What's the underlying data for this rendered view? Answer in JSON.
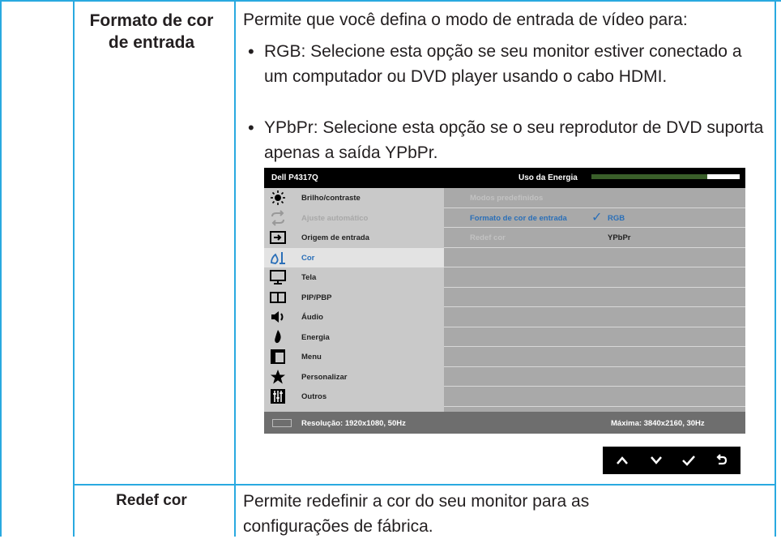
{
  "rows": [
    {
      "label": "Formato de cor de entrada",
      "label_lines": [
        "Formato de cor",
        "de entrada"
      ],
      "intro": "Permite que você defina o modo de entrada de vídeo para:",
      "bullets": [
        "RGB: Selecione esta opção se seu monitor estiver conectado a um computador ou DVD player usando o cabo HDMI.",
        "YPbPr: Selecione esta opção se o seu reprodutor de DVD suporta apenas a saída YPbPr."
      ]
    },
    {
      "label": "Redef cor",
      "desc": "Permite redefinir a cor do seu monitor para as configurações de fábrica."
    }
  ],
  "osd": {
    "model": "Dell P4317Q",
    "energy_label": "Uso da Energia",
    "energy_level_percent": 78,
    "menu": [
      {
        "label": "Brilho/contraste",
        "icon": "brightness-icon",
        "state": "normal"
      },
      {
        "label": "Ajuste automático",
        "icon": "auto-adjust-icon",
        "state": "disabled"
      },
      {
        "label": "Origem de entrada",
        "icon": "input-source-icon",
        "state": "normal"
      },
      {
        "label": "Cor",
        "icon": "color-icon",
        "state": "active"
      },
      {
        "label": "Tela",
        "icon": "display-icon",
        "state": "normal"
      },
      {
        "label": "PIP/PBP",
        "icon": "pip-icon",
        "state": "normal"
      },
      {
        "label": "Áudio",
        "icon": "speaker-icon",
        "state": "normal"
      },
      {
        "label": "Energia",
        "icon": "energy-icon",
        "state": "normal"
      },
      {
        "label": "Menu",
        "icon": "menu-icon",
        "state": "normal"
      },
      {
        "label": "Personalizar",
        "icon": "star-icon",
        "state": "normal"
      },
      {
        "label": "Outros",
        "icon": "others-icon",
        "state": "normal"
      }
    ],
    "submenu": [
      {
        "label": "Modos predefinidos",
        "state": "dim"
      },
      {
        "label": "Formato de cor de entrada",
        "state": "selected"
      },
      {
        "label": "Redef cor",
        "state": "dim"
      }
    ],
    "options": {
      "rgb": "RGB",
      "ypbpr": "YPbPr"
    },
    "footer": {
      "resolution": "Resolução: 1920x1080, 50Hz",
      "max": "Máxima: 3840x2160, 30Hz"
    },
    "buttons": [
      "up-arrow-icon",
      "down-arrow-icon",
      "check-icon",
      "back-icon"
    ]
  },
  "colors": {
    "border": "#29a9e0",
    "accent_blue": "#2a6fb8",
    "energy_bar": "#3a5f2a"
  }
}
